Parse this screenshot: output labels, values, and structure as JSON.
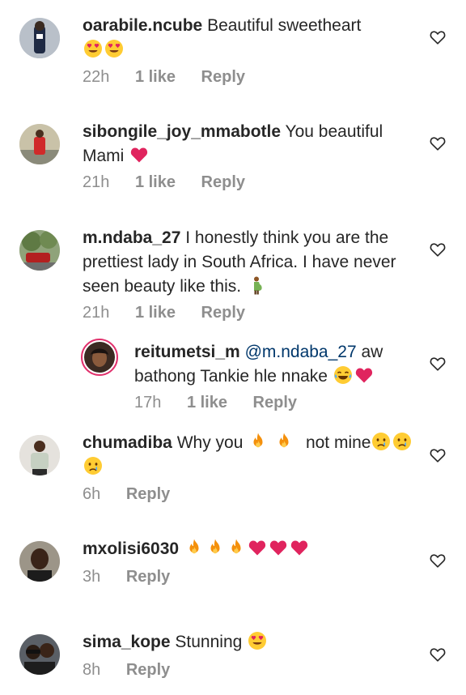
{
  "comments": [
    {
      "username": "oarabile.ncube",
      "text": "Beautiful sweetheart",
      "emojis": [
        "heart-eyes",
        "heart-eyes"
      ],
      "time": "22h",
      "likes": "1 like",
      "reply": "Reply"
    },
    {
      "username": "sibongile_joy_mmabotle",
      "text": "You beautiful Mami",
      "emojis": [
        "red-heart"
      ],
      "time": "21h",
      "likes": "1 like",
      "reply": "Reply"
    },
    {
      "username": "m.ndaba_27",
      "text": "I honestly think you are the prettiest lady in South Africa. I have never seen beauty like this.",
      "emojis": [
        "pregnant-man"
      ],
      "time": "21h",
      "likes": "1 like",
      "reply": "Reply"
    },
    {
      "username": "reitumetsi_m",
      "mention": "@m.ndaba_27",
      "text": "aw bathong Tankie hle nnake",
      "emojis": [
        "tears-of-joy",
        "red-heart"
      ],
      "time": "17h",
      "likes": "1 like",
      "reply": "Reply"
    },
    {
      "username": "chumadiba",
      "text_before": "Why you",
      "emojis_mid": [
        "fire",
        "fire"
      ],
      "text_after": "not mine",
      "emojis": [
        "crying-face",
        "crying-face",
        "crying-face"
      ],
      "time": "6h",
      "reply": "Reply"
    },
    {
      "username": "mxolisi6030",
      "emojis": [
        "fire",
        "fire",
        "fire",
        "red-heart",
        "red-heart",
        "red-heart"
      ],
      "time": "3h",
      "reply": "Reply"
    },
    {
      "username": "sima_kope",
      "text": "Stunning",
      "emojis": [
        "heart-eyes"
      ],
      "time": "8h",
      "reply": "Reply"
    }
  ]
}
